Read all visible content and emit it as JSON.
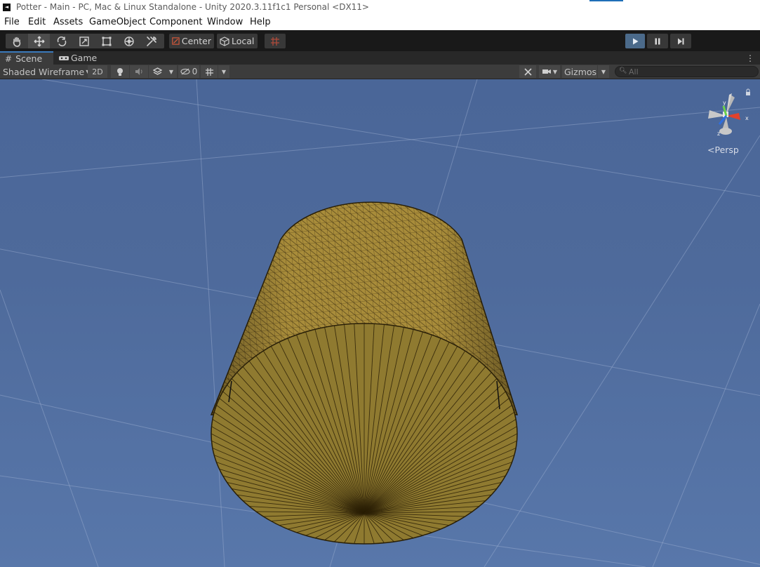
{
  "window": {
    "title": "Potter - Main - PC, Mac & Linux Standalone - Unity 2020.3.11f1c1 Personal <DX11>",
    "app_icon": "unity-icon"
  },
  "menu": [
    "File",
    "Edit",
    "Assets",
    "GameObject",
    "Component",
    "Window",
    "Help"
  ],
  "toolbar": {
    "tools": [
      "hand-icon",
      "move-icon",
      "rotate-icon",
      "scale-icon",
      "rect-icon",
      "transform-icon",
      "custom-tool-icon"
    ],
    "selected_tool": "move-icon",
    "pivot_mode": "Center",
    "pivot_rotation": "Local",
    "playback": [
      "play-icon",
      "pause-icon",
      "step-icon"
    ],
    "accent": "#4b6a8a"
  },
  "tabs": [
    {
      "label": "Scene",
      "icon": "scene-hash-icon",
      "active": true
    },
    {
      "label": "Game",
      "icon": "gamepad-icon",
      "active": false
    }
  ],
  "scene_toolbar": {
    "draw_mode": "Shaded Wireframe",
    "mode_2d": "2D",
    "hidden_count": "0",
    "gizmos": "Gizmos",
    "search_placeholder": "All"
  },
  "scene_view": {
    "projection": "Persp",
    "gizmo_axes": {
      "y": "y",
      "x": "x",
      "z": "z"
    },
    "object": "Cylinder",
    "object_color": "#8f7a30",
    "sky_color": "#4e6a9b"
  }
}
